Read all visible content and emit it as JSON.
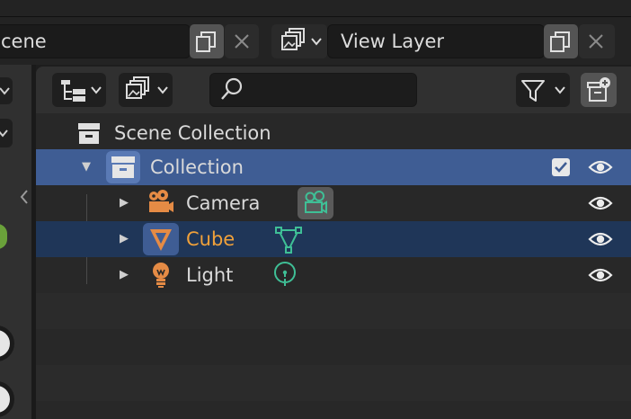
{
  "header": {
    "scene_name": "cene",
    "view_layer_name": "View Layer"
  },
  "outliner": {
    "search": {
      "value": "",
      "placeholder": ""
    },
    "rows": [
      {
        "label": "Scene Collection",
        "type": "scene-collection"
      },
      {
        "label": "Collection",
        "type": "collection",
        "expanded": true,
        "selected": true,
        "checked": true
      },
      {
        "label": "Camera",
        "type": "object",
        "data_icon": "camera-data-icon"
      },
      {
        "label": "Cube",
        "type": "object",
        "active": true,
        "data_icon": "mesh-data-icon"
      },
      {
        "label": "Light",
        "type": "object",
        "data_icon": "light-data-icon"
      }
    ]
  },
  "colors": {
    "selected_row": "#3f5d94",
    "active_row": "#1f3658",
    "active_text": "#f0a13a",
    "object_icon": "#e58b45",
    "data_icon": "#3fbf96"
  }
}
